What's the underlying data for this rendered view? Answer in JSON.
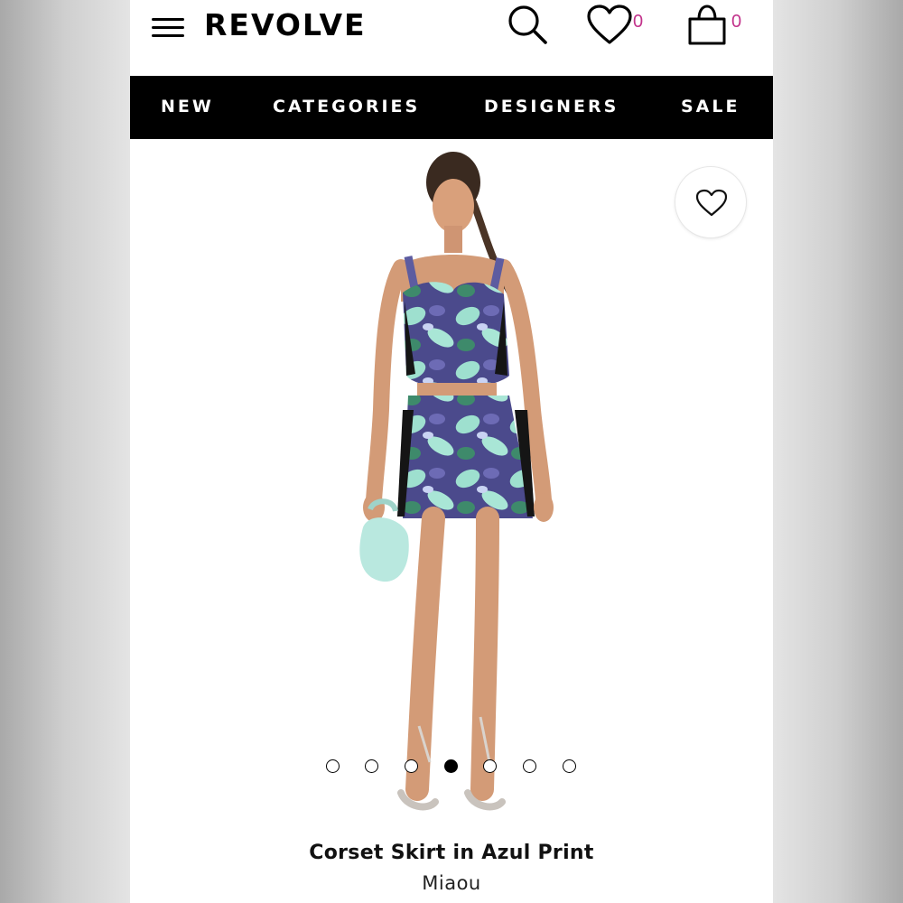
{
  "header": {
    "logo": "REVOLVE",
    "wishlist_count": "0",
    "bag_count": "0"
  },
  "nav": {
    "items": [
      {
        "label": "NEW"
      },
      {
        "label": "CATEGORIES"
      },
      {
        "label": "DESIGNERS"
      },
      {
        "label": "SALE"
      }
    ]
  },
  "gallery": {
    "image_count": 7,
    "active_index": 3
  },
  "product": {
    "title": "Corset Skirt in Azul Print",
    "brand": "Miaou"
  },
  "colors": {
    "nav_background": "#000000",
    "count_accent": "#c2328b",
    "print_dark": "#4b4a8c",
    "print_mint": "#9ee0cf",
    "bag_mint": "#b9e8df"
  },
  "icons": [
    "menu-icon",
    "search-icon",
    "heart-icon",
    "shopping-bag-icon"
  ]
}
